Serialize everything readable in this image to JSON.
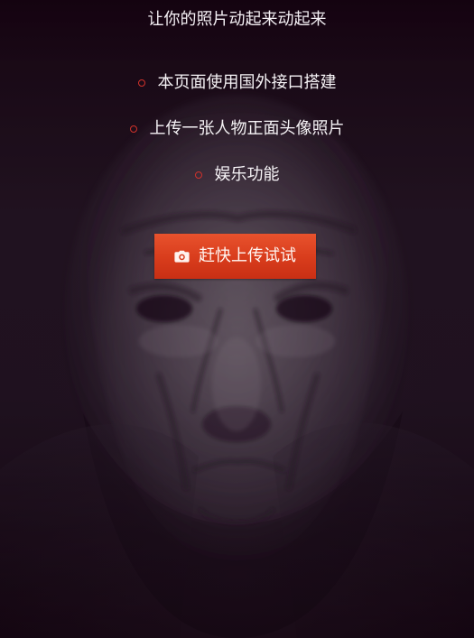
{
  "header": {
    "title": "让你的照片动起来动起来"
  },
  "features": {
    "items": [
      {
        "label": "本页面使用国外接口搭建"
      },
      {
        "label": "上传一张人物正面头像照片"
      },
      {
        "label": "娱乐功能"
      }
    ]
  },
  "upload": {
    "label": "赶快上传试试",
    "icon": "camera-icon"
  },
  "colors": {
    "background": "#140611",
    "accent": "#d83c1c",
    "bullet": "#d1322b",
    "text": "#f5f2f5"
  }
}
